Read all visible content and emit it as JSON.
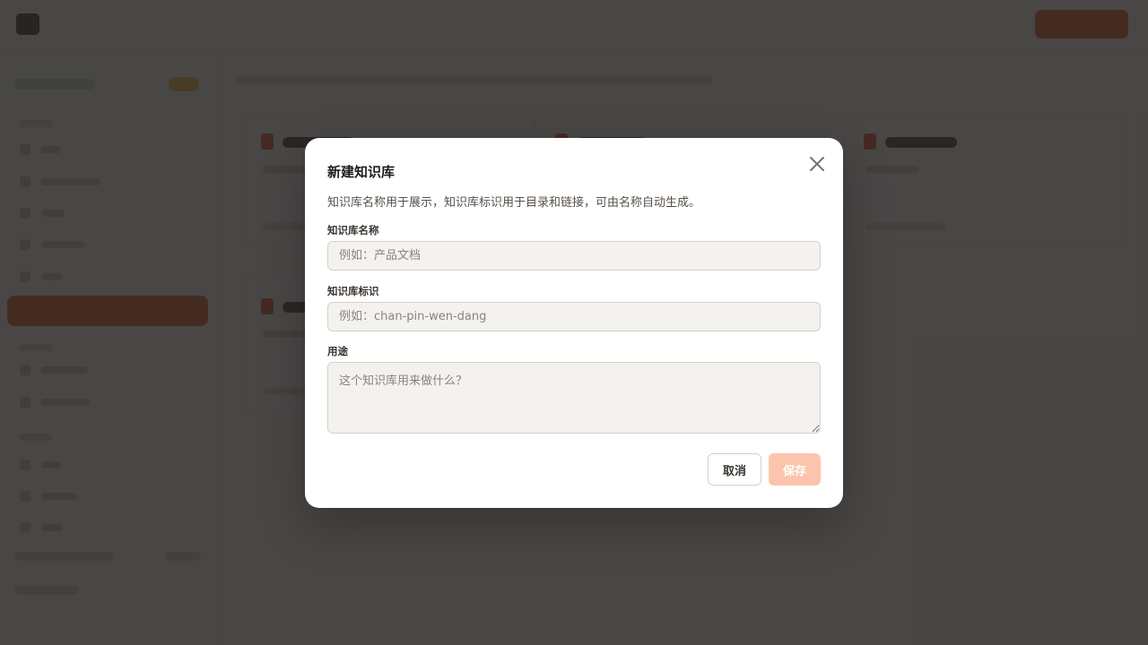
{
  "modal": {
    "title": "新建知识库",
    "description": "知识库名称用于展示，知识库标识用于目录和链接，可由名称自动生成。",
    "fields": {
      "name": {
        "label": "知识库名称",
        "value": "",
        "placeholder": "例如：产品文档"
      },
      "slug": {
        "label": "知识库标识",
        "value": "",
        "placeholder": "例如：chan-pin-wen-dang"
      },
      "purpose": {
        "label": "用途",
        "value": "",
        "placeholder": "这个知识库用来做什么？"
      }
    },
    "buttons": {
      "cancel": "取消",
      "save": "保存"
    },
    "close_icon": "close-icon"
  },
  "colors": {
    "accent": "#e0531f",
    "save_disabled": "#fcc4ad",
    "overlay": "rgba(38,36,34,0.84)"
  }
}
